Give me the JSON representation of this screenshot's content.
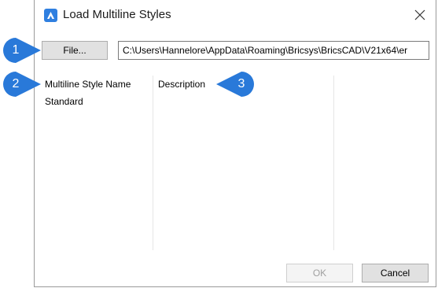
{
  "dialog": {
    "title": "Load Multiline Styles",
    "file_button_label": "File...",
    "path_value": "C:\\Users\\Hannelore\\AppData\\Roaming\\Bricsys\\BricsCAD\\V21x64\\er",
    "columns": [
      "Multiline Style Name",
      "Description"
    ],
    "rows": [
      {
        "name": "Standard",
        "description": ""
      }
    ],
    "ok_label": "OK",
    "cancel_label": "Cancel",
    "ok_enabled": false
  },
  "callouts": [
    "1",
    "2",
    "3"
  ],
  "colors": {
    "callout_blue": "#2979d9",
    "app_icon_blue": "#2f7fe0"
  },
  "icons": {
    "app": "bricscad-app-icon",
    "close": "close-icon"
  }
}
